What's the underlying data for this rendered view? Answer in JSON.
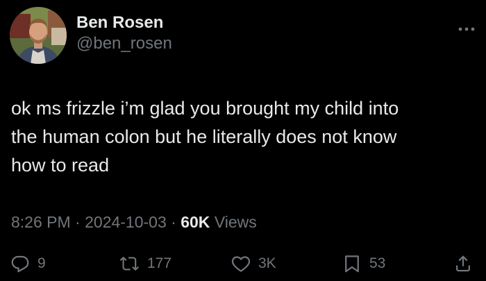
{
  "author": {
    "display_name": "Ben Rosen",
    "handle": "@ben_rosen"
  },
  "tweet": {
    "text": "ok ms frizzle i’m glad you brought my child into\nthe human colon but he literally does not know\nhow to read",
    "time": "8:26 PM",
    "date": "2024-10-03",
    "separator": "·",
    "views_count": "60K",
    "views_label": "Views"
  },
  "actions": {
    "replies": "9",
    "reposts": "177",
    "likes": "3K",
    "bookmarks": "53"
  },
  "colors": {
    "background": "#000000",
    "primary_text": "#e7e9ea",
    "secondary_text": "#71767b"
  },
  "icons": [
    "avatar-photo",
    "more-icon",
    "reply-icon",
    "repost-icon",
    "like-icon",
    "bookmark-icon",
    "share-icon"
  ]
}
